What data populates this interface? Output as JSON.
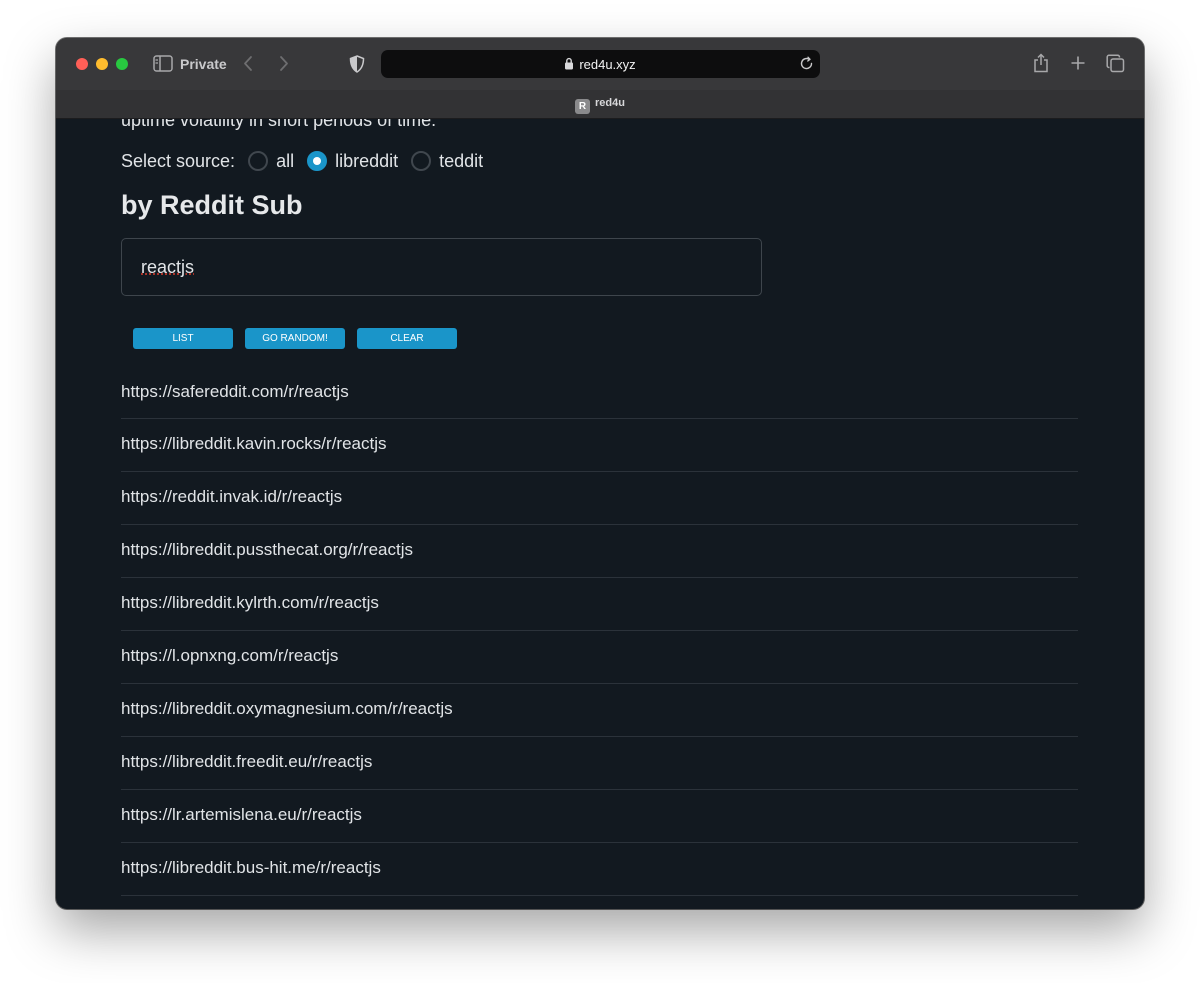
{
  "browser": {
    "mode_label": "Private",
    "url": "red4u.xyz",
    "tab_title": "red4u",
    "favicon_letter": "R"
  },
  "page": {
    "intro_text_partial": "uptime volatility in short periods of time.",
    "source_label": "Select source:",
    "sources": [
      {
        "label": "all",
        "selected": false
      },
      {
        "label": "libreddit",
        "selected": true
      },
      {
        "label": "teddit",
        "selected": false
      }
    ],
    "section_title": "by Reddit Sub",
    "search_value": "reactjs",
    "buttons": {
      "list": "LIST",
      "random": "GO RANDOM!",
      "clear": "CLEAR"
    },
    "accent_color": "#1a95c9",
    "results": [
      "https://safereddit.com/r/reactjs",
      "https://libreddit.kavin.rocks/r/reactjs",
      "https://reddit.invak.id/r/reactjs",
      "https://libreddit.pussthecat.org/r/reactjs",
      "https://libreddit.kylrth.com/r/reactjs",
      "https://l.opnxng.com/r/reactjs",
      "https://libreddit.oxymagnesium.com/r/reactjs",
      "https://libreddit.freedit.eu/r/reactjs",
      "https://lr.artemislena.eu/r/reactjs",
      "https://libreddit.bus-hit.me/r/reactjs"
    ]
  }
}
